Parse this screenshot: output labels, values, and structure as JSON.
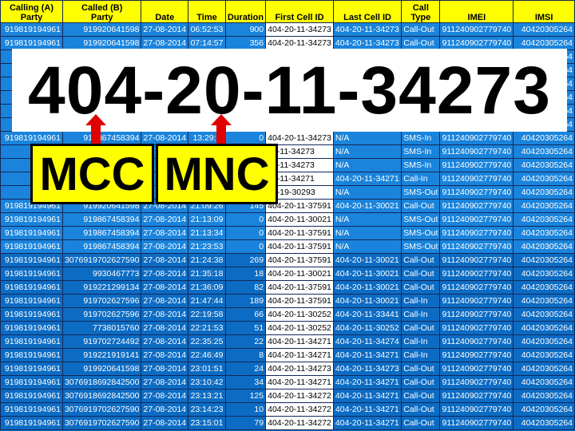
{
  "colors": {
    "header": "#ffff00",
    "cell": "#1a84dc",
    "cell_dark": "#0c6cc4",
    "first_cell_col": "#ffffff",
    "arrow": "#e00000",
    "tag": "#ffff00"
  },
  "columns": [
    "Calling (A)\nParty",
    "Called (B)\nParty",
    "Date",
    "Time",
    "Duration",
    "First Cell ID",
    "Last Cell ID",
    "Call\nType",
    "IMEI",
    "IMSI"
  ],
  "rows": [
    [
      "919819194961",
      "919920641598",
      "27-08-2014",
      "06:52:53",
      "900",
      "404-20-11-34273",
      "404-20-11-34273",
      "Call-Out",
      "911240902779740",
      "40420305264"
    ],
    [
      "919819194961",
      "919920641598",
      "27-08-2014",
      "07:14:57",
      "356",
      "404-20-11-34273",
      "404-20-11-34273",
      "Call-Out",
      "911240902779740",
      "40420305264"
    ],
    [
      "",
      "",
      "",
      "",
      "",
      "",
      "",
      "",
      "",
      "64"
    ],
    [
      "",
      "",
      "",
      "",
      "",
      "",
      "",
      "",
      "",
      "64"
    ],
    [
      "",
      "",
      "",
      "",
      "",
      "",
      "",
      "",
      "",
      "64"
    ],
    [
      "",
      "",
      "",
      "",
      "",
      "",
      "",
      "",
      "",
      "64"
    ],
    [
      "",
      "",
      "",
      "",
      "",
      "",
      "",
      "",
      "",
      "64"
    ],
    [
      "",
      "",
      "",
      "",
      "",
      "",
      "",
      "",
      "",
      "64"
    ],
    [
      "919819194961",
      "919867458394",
      "27-08-2014",
      "13:29:0",
      "0",
      "404-20-11-34273",
      "N/A",
      "SMS-In",
      "911240902779740",
      "40420305264"
    ],
    [
      "9198",
      "",
      "",
      "",
      "",
      "20-11-34273",
      "N/A",
      "SMS-In",
      "911240902779740",
      "40420305264"
    ],
    [
      "9198",
      "",
      "",
      "",
      "",
      "20-11-34273",
      "N/A",
      "SMS-In",
      "911240902779740",
      "40420305264"
    ],
    [
      "9198",
      "",
      "",
      "",
      "",
      "20-11-34271",
      "404-20-11-34271",
      "Call-In",
      "911240902779740",
      "40420305264"
    ],
    [
      "9198",
      "",
      "",
      "",
      "",
      "20-19-30293",
      "N/A",
      "SMS-Out",
      "911240902779740",
      "40420305264"
    ],
    [
      "919819194961",
      "919920641598",
      "27-08-2014",
      "21:09:26",
      "145",
      "404-20-11-37591",
      "404-20-11-30021",
      "Call-Out",
      "911240902779740",
      "40420305264"
    ],
    [
      "919819194961",
      "919867458394",
      "27-08-2014",
      "21:13:09",
      "0",
      "404-20-11-30021",
      "N/A",
      "SMS-Out",
      "911240902779740",
      "40420305264"
    ],
    [
      "919819194961",
      "919867458394",
      "27-08-2014",
      "21:13:34",
      "0",
      "404-20-11-37591",
      "N/A",
      "SMS-Out",
      "911240902779740",
      "40420305264"
    ],
    [
      "919819194961",
      "919867458394",
      "27-08-2014",
      "21:23:53",
      "0",
      "404-20-11-37591",
      "N/A",
      "SMS-Out",
      "911240902779740",
      "40420305264"
    ],
    [
      "919819194961",
      "307691970262759​0",
      "27-08-2014",
      "21:24:38",
      "269",
      "404-20-11-37591",
      "404-20-11-30021",
      "Call-Out",
      "911240902779740",
      "40420305264"
    ],
    [
      "919819194961",
      "9930467773",
      "27-08-2014",
      "21:35:18",
      "18",
      "404-20-11-30021",
      "404-20-11-30021",
      "Call-Out",
      "911240902779740",
      "40420305264"
    ],
    [
      "919819194961",
      "919221299134",
      "27-08-2014",
      "21:36:09",
      "82",
      "404-20-11-37591",
      "404-20-11-30021",
      "Call-Out",
      "911240902779740",
      "40420305264"
    ],
    [
      "919819194961",
      "919702627596",
      "27-08-2014",
      "21:47:44",
      "189",
      "404-20-11-37591",
      "404-20-11-30021",
      "Call-In",
      "911240902779740",
      "40420305264"
    ],
    [
      "919819194961",
      "919702627596",
      "27-08-2014",
      "22:19:58",
      "66",
      "404-20-11-30252",
      "404-20-11-33441",
      "Call-In",
      "911240902779740",
      "40420305264"
    ],
    [
      "919819194961",
      "7738015760",
      "27-08-2014",
      "22:21:53",
      "51",
      "404-20-11-30252",
      "404-20-11-30252",
      "Call-Out",
      "911240902779740",
      "40420305264"
    ],
    [
      "919819194961",
      "919702724492",
      "27-08-2014",
      "22:35:25",
      "22",
      "404-20-11-34271",
      "404-20-11-34274",
      "Call-In",
      "911240902779740",
      "40420305264"
    ],
    [
      "919819194961",
      "919221919141",
      "27-08-2014",
      "22:46:49",
      "8",
      "404-20-11-34271",
      "404-20-11-34271",
      "Call-In",
      "911240902779740",
      "40420305264"
    ],
    [
      "919819194961",
      "919920641598",
      "27-08-2014",
      "23:01:51",
      "24",
      "404-20-11-34273",
      "404-20-11-34273",
      "Call-Out",
      "911240902779740",
      "40420305264"
    ],
    [
      "919819194961",
      "307691869284250​0",
      "27-08-2014",
      "23:10:42",
      "34",
      "404-20-11-34271",
      "404-20-11-34271",
      "Call-Out",
      "911240902779740",
      "40420305264"
    ],
    [
      "919819194961",
      "307691869284250​0",
      "27-08-2014",
      "23:13:21",
      "125",
      "404-20-11-34272",
      "404-20-11-34271",
      "Call-Out",
      "911240902779740",
      "40420305264"
    ],
    [
      "919819194961",
      "307691970262759​0",
      "27-08-2014",
      "23:14:23",
      "10",
      "404-20-11-34272",
      "404-20-11-34271",
      "Call-Out",
      "911240902779740",
      "40420305264"
    ],
    [
      "919819194961",
      "307691970262759​0",
      "27-08-2014",
      "23:15:01",
      "79",
      "404-20-11-34272",
      "404-20-11-34271",
      "Call-Out",
      "911240902779740",
      "40420305264"
    ]
  ],
  "overlay": {
    "cell_id": "404-20-11-34273",
    "mcc_label": "MCC",
    "mnc_label": "MNC"
  }
}
